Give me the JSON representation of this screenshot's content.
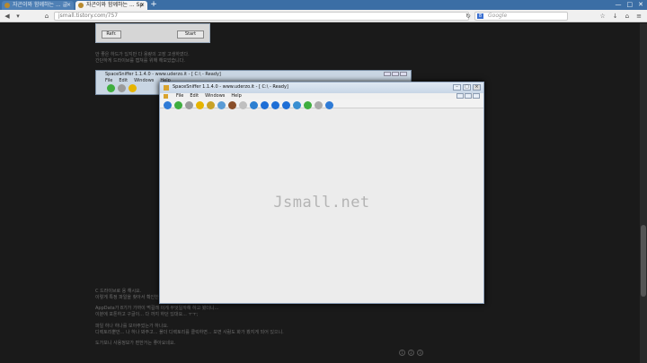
{
  "browser": {
    "tabs": [
      {
        "label": "자곤이와 함께하는 ... 글"
      },
      {
        "label": "자곤이와 함께하는 ... Sp"
      }
    ],
    "url": "jsmall.tistory.com/757",
    "search_placeholder": "Google",
    "search_engine_letter": "8"
  },
  "page": {
    "top_screenshot": {
      "left_button": "Refr.",
      "right_button": "Start"
    },
    "paragraph1": [
      "안 좋은 하드가 있지만 다 용량의 고장 고생하였다.",
      "간단하게 드라이브를 캡쳐를 위해 해보았습니다."
    ],
    "mid_screenshot": {
      "title": "SpaceSniffer 1.1.4.0 - www.uderzo.it - [ C:\\ - Ready]",
      "menu": [
        "File",
        "Edit",
        "Windows",
        "Help"
      ]
    },
    "paragraph2": [
      "C 드라이브로 용 해시요.",
      "이렇게 특정 파일을 찾아서 확인한다."
    ],
    "paragraph3": [
      "AppData가 8기가 가까이 먹길래 이게 무엇일까해 하고 봤더니...",
      "이분에 포톤하고 구글이... 다 까지 하던 있대요... ㅜㅜ;"
    ],
    "paragraph4": [
      "파일 하나 하나를 보아주었는가 하나요.",
      "디렉토리뿐만... 나 하나 봐주고... 폴더 디렉토리를 클릭하면... 보면 사람도 화가 봤지게 되어 있으니."
    ],
    "paragraph5": [
      "도가보니 사용정보가 편한거는 좋아요네요."
    ]
  },
  "window": {
    "title": "SpaceSniffer 1.1.4.0 - www.uderzo.it - [ C:\\ - Ready]",
    "menu": [
      "File",
      "Edit",
      "Windows",
      "Help"
    ],
    "watermark": "Jsmall.net",
    "toolbar_colors": [
      "#2f7bd6",
      "#3fae3f",
      "#9b9b9b",
      "#e6b400",
      "#c9a227",
      "#5a9bd5",
      "#8a4f2a",
      "#c0c0c0",
      "#2c7fd1",
      "#1f6fd6",
      "#1f6fd6",
      "#1f6fd6",
      "#3a8fd1",
      "#3fae3f",
      "#aaaaaa",
      "#2f7bd6"
    ]
  },
  "footer": {
    "dots": [
      "1",
      "2",
      "3"
    ]
  }
}
